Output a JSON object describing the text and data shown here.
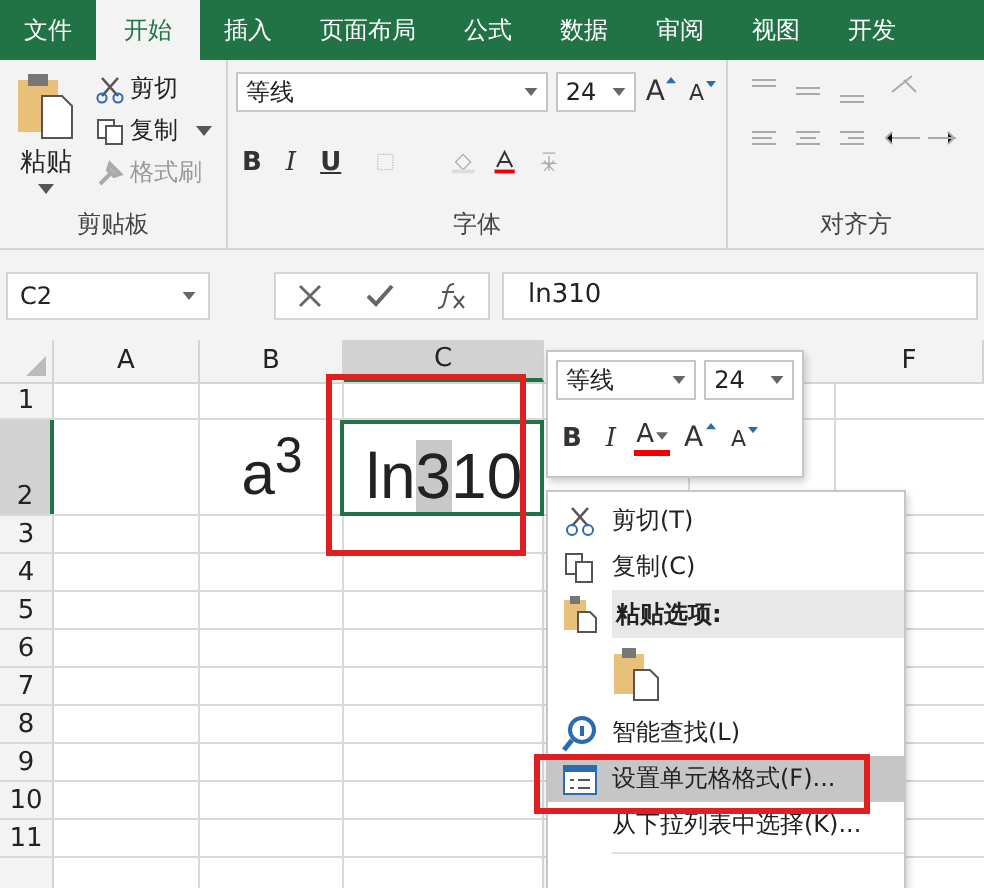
{
  "tabs": [
    {
      "label": "文件",
      "selected": false
    },
    {
      "label": "开始",
      "selected": true
    },
    {
      "label": "插入",
      "selected": false
    },
    {
      "label": "页面布局",
      "selected": false
    },
    {
      "label": "公式",
      "selected": false
    },
    {
      "label": "数据",
      "selected": false
    },
    {
      "label": "审阅",
      "selected": false
    },
    {
      "label": "视图",
      "selected": false
    },
    {
      "label": "开发",
      "selected": false
    }
  ],
  "ribbon": {
    "clipboard": {
      "paste": "粘贴",
      "cut": "剪切",
      "copy": "复制",
      "format_painter": "格式刷",
      "label": "剪贴板"
    },
    "font": {
      "font_name": "等线",
      "font_size": "24",
      "grow_font": "A",
      "shrink_font": "A",
      "bold": "B",
      "italic": "I",
      "underline": "U",
      "label": "字体"
    },
    "alignment": {
      "label": "对齐方"
    }
  },
  "formula_bar": {
    "name_box": "C2",
    "formula": "ln310"
  },
  "sheet": {
    "columns": [
      {
        "label": "A",
        "selected": false
      },
      {
        "label": "B",
        "selected": false
      },
      {
        "label": "C",
        "selected": true
      },
      {
        "selected": false
      },
      {
        "selected": false
      },
      {
        "label": "F",
        "selected": false
      }
    ],
    "rows": [
      {
        "label": "1",
        "selected": false
      },
      {
        "label": "2",
        "selected": true,
        "cells": [
          "",
          "a$^{3}$",
          [
            {
              "text": "ln",
              "selected": false
            },
            {
              "text": "3",
              "selected": true
            },
            {
              "text": "10",
              "selected": false
            }
          ]
        ]
      },
      {
        "label": "3",
        "selected": false
      },
      {
        "label": "4",
        "selected": false
      },
      {
        "label": "5",
        "selected": false
      },
      {
        "label": "6",
        "selected": false
      },
      {
        "label": "7",
        "selected": false
      },
      {
        "label": "8",
        "selected": false
      },
      {
        "label": "9",
        "selected": false
      },
      {
        "label": "10",
        "selected": false
      },
      {
        "label": "11",
        "selected": false
      }
    ]
  },
  "mini_toolbar": {
    "font_name": "等线",
    "font_size": "24",
    "bold": "B",
    "italic": "I",
    "font_color": "A",
    "grow_font": "A",
    "shrink_font": "A"
  },
  "context_menu": [
    {
      "kind": "cut",
      "label": "剪切(T)",
      "selected": false
    },
    {
      "kind": "copy",
      "label": "复制(C)",
      "selected": false
    },
    {
      "kind": "header",
      "label": "粘贴选项:",
      "selected": false
    },
    {
      "kind": "paste",
      "selected": false
    },
    {
      "kind": "lookup",
      "label": "智能查找(L)",
      "selected": false
    },
    {
      "kind": "format",
      "label": "设置单元格格式(F)...",
      "selected": true
    },
    {
      "kind": "plain",
      "label": "从下拉列表中选择(K)...",
      "selected": false
    }
  ]
}
